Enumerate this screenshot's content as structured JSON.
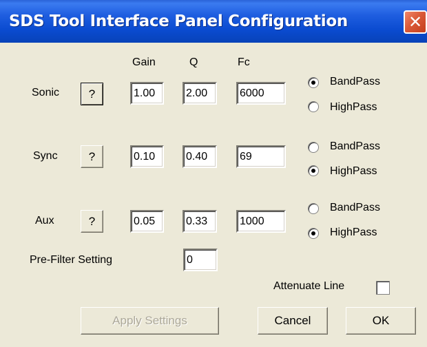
{
  "window": {
    "title": "SDS Tool Interface Panel  Configuration",
    "close_glyph": "✕"
  },
  "columns": {
    "gain": "Gain",
    "q": "Q",
    "fc": "Fc"
  },
  "rows": [
    {
      "label": "Sonic",
      "help": "?",
      "gain": "1.00",
      "q": "2.00",
      "fc": "6000",
      "selected": "BandPass"
    },
    {
      "label": "Sync",
      "help": "?",
      "gain": "0.10",
      "q": "0.40",
      "fc": "69",
      "selected": "HighPass"
    },
    {
      "label": "Aux",
      "help": "?",
      "gain": "0.05",
      "q": "0.33",
      "fc": "1000",
      "selected": "HighPass"
    }
  ],
  "filter_options": {
    "bandpass": "BandPass",
    "highpass": "HighPass"
  },
  "prefilter": {
    "label": "Pre-Filter Setting",
    "value": "0"
  },
  "attenuate": {
    "label": "Attenuate Line",
    "checked": false
  },
  "buttons": {
    "apply": "Apply Settings",
    "cancel": "Cancel",
    "ok": "OK"
  }
}
